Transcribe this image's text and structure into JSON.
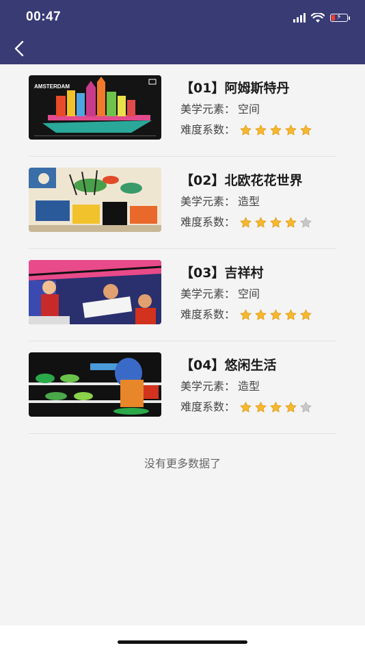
{
  "status_bar": {
    "time": "00:47"
  },
  "items": [
    {
      "title": "【01】阿姆斯特丹",
      "element_label": "美学元素：",
      "element_value": "空间",
      "difficulty_label": "难度系数：",
      "difficulty": 5,
      "thumb_text": "AMSTERDAM"
    },
    {
      "title": "【02】北欧花花世界",
      "element_label": "美学元素：",
      "element_value": "造型",
      "difficulty_label": "难度系数：",
      "difficulty": 4
    },
    {
      "title": "【03】吉祥村",
      "element_label": "美学元素：",
      "element_value": "空间",
      "difficulty_label": "难度系数：",
      "difficulty": 5
    },
    {
      "title": "【04】悠闲生活",
      "element_label": "美学元素：",
      "element_value": "造型",
      "difficulty_label": "难度系数：",
      "difficulty": 4
    }
  ],
  "footer": {
    "no_more": "没有更多数据了"
  },
  "colors": {
    "header": "#383b74",
    "star_on": "#f5b82e",
    "star_off": "#c8c8c8"
  }
}
